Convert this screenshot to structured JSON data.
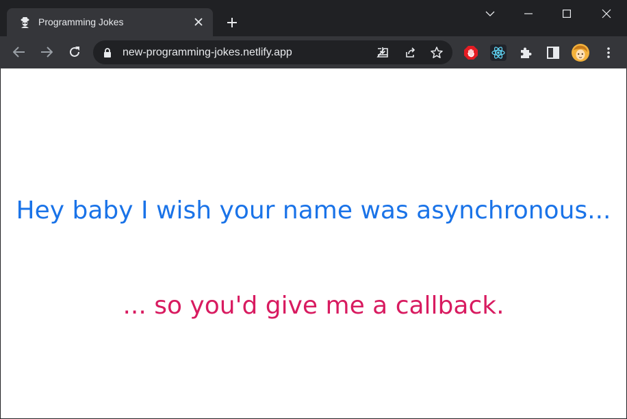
{
  "tab": {
    "title": "Programming Jokes",
    "favicon": "spy-icon"
  },
  "window_controls": [
    "chevron-down-icon",
    "minimize-icon",
    "maximize-icon",
    "close-icon"
  ],
  "toolbar": {
    "url": "new-programming-jokes.netlify.app"
  },
  "extensions": [
    "adblock-icon",
    "react-devtools-icon",
    "puzzle-icon",
    "side-panel-icon",
    "profile-avatar",
    "more-menu-icon"
  ],
  "joke": {
    "setup": "Hey baby I wish your name was asynchronous...",
    "punchline": "... so you'd give me a callback."
  },
  "colors": {
    "setup": "#1a73e8",
    "punchline": "#d81b60",
    "chrome_dark": "#202124",
    "toolbar": "#35363a"
  }
}
